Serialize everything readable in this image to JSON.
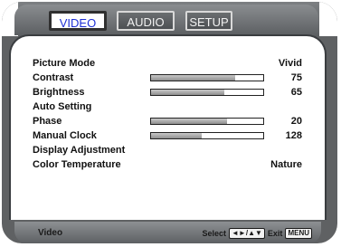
{
  "tabs": [
    {
      "label": "VIDEO",
      "active": true
    },
    {
      "label": "AUDIO",
      "active": false
    },
    {
      "label": "SETUP",
      "active": false
    }
  ],
  "menu": {
    "items": [
      {
        "label": "Picture Mode",
        "value": "Vivid"
      },
      {
        "label": "Contrast",
        "value": "75",
        "level": 0.75
      },
      {
        "label": "Brightness",
        "value": "65",
        "level": 0.65
      },
      {
        "label": "Auto Setting",
        "value": ""
      },
      {
        "label": "Phase",
        "value": "20",
        "level": 0.68
      },
      {
        "label": "Manual Clock",
        "value": "128",
        "level": 0.45
      },
      {
        "label": "Display Adjustment",
        "value": ""
      },
      {
        "label": "Color Temperature",
        "value": "Nature"
      }
    ]
  },
  "footer": {
    "section": "Video",
    "select_label": "Select",
    "select_key": "◄►/▲▼",
    "exit_label": "Exit",
    "exit_key": "MENU"
  },
  "colors": {
    "active_tab_text": "#1e30d6",
    "frame": "#5f6163",
    "panel": "#ffffff"
  }
}
